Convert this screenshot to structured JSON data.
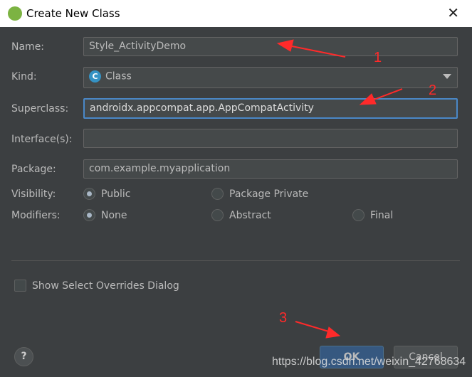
{
  "window": {
    "title": "Create New Class"
  },
  "form": {
    "name_label": "Name:",
    "name_value": "Style_ActivityDemo",
    "kind_label": "Kind:",
    "kind_value": "Class",
    "kind_icon_letter": "C",
    "superclass_label": "Superclass:",
    "superclass_value": "androidx.appcompat.app.AppCompatActivity",
    "interfaces_label": "Interface(s):",
    "interfaces_value": "",
    "package_label": "Package:",
    "package_value": "com.example.myapplication",
    "visibility_label": "Visibility:",
    "visibility_options": [
      {
        "label": "Public",
        "selected": true
      },
      {
        "label": "Package Private",
        "selected": false
      }
    ],
    "modifiers_label": "Modifiers:",
    "modifier_options": [
      {
        "label": "None",
        "selected": true
      },
      {
        "label": "Abstract",
        "selected": false
      },
      {
        "label": "Final",
        "selected": false
      }
    ],
    "overrides_label": "Show Select Overrides Dialog",
    "overrides_checked": false
  },
  "buttons": {
    "help": "?",
    "ok": "OK",
    "cancel": "Cancel"
  },
  "annotations": [
    "1",
    "2",
    "3"
  ],
  "watermark": "https://blog.csdn.net/weixin_42768634"
}
